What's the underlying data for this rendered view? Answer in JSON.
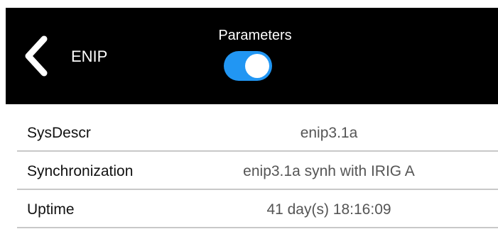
{
  "header": {
    "back_icon": "chevron-left-icon",
    "title": "ENIP",
    "parameters_label": "Parameters",
    "parameters_toggle": {
      "state": "on",
      "color": "#2196f3"
    }
  },
  "params": [
    {
      "key": "SysDescr",
      "value": "enip3.1a"
    },
    {
      "key": "Synchronization",
      "value": "enip3.1a synh with IRIG A"
    },
    {
      "key": "Uptime",
      "value": "41 day(s) 18:16:09"
    }
  ]
}
